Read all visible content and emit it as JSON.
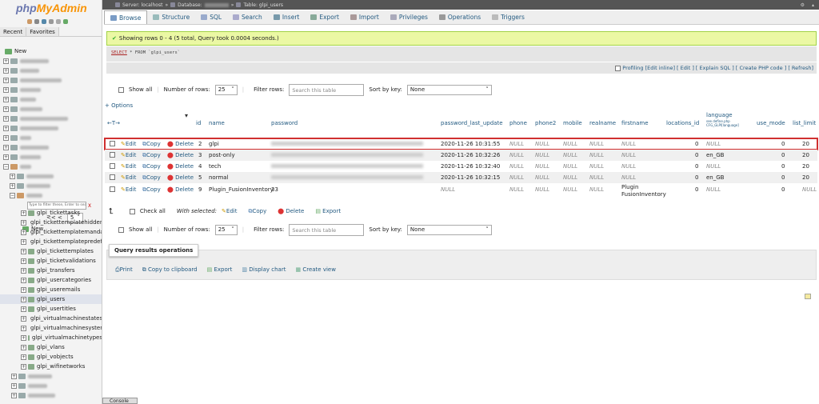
{
  "logo": {
    "a": "php",
    "b": "MyAdmin"
  },
  "left": {
    "tabs": [
      "Recent",
      "Favorites"
    ],
    "new_label": "New",
    "tables": [
      "glpi_tickettasks",
      "glpi_tickettemplatehiddenf",
      "glpi_tickettemplatemandat",
      "glpi_tickettemplatepredefi",
      "glpi_tickettemplates",
      "glpi_ticketvalidations",
      "glpi_transfers",
      "glpi_usercategories",
      "glpi_useremails",
      "glpi_users",
      "glpi_usertitles",
      "glpi_virtualmachinestates",
      "glpi_virtualmachinesystem",
      "glpi_virtualmachinetypes",
      "glpi_vlans",
      "glpi_vobjects",
      "glpi_wifinetworks"
    ],
    "filter_placeholder": "Type to filter these, Enter to search all",
    "filter_x": "X",
    "pager_prev": "<< <",
    "pager_val": "5"
  },
  "breadcrumb": {
    "server": "Server: localhost",
    "db": "Database:",
    "table": "Table: glpi_users"
  },
  "tabs": [
    "Browse",
    "Structure",
    "SQL",
    "Search",
    "Insert",
    "Export",
    "Import",
    "Privileges",
    "Operations",
    "Triggers"
  ],
  "message": "Showing rows 0 - 4 (5 total, Query took 0.0004 seconds.)",
  "sql": {
    "select": "SELECT",
    "rest": " * FROM `glpi_users`"
  },
  "sql_links": "Profiling [Edit inline] [ Edit ] [ Explain SQL ] [ Create PHP code ] [ Refresh]",
  "nav": {
    "show_all": "Show all",
    "num_rows_label": "Number of rows:",
    "num_rows": "25",
    "filter_label": "Filter rows:",
    "filter_placeholder": "Search this table",
    "sort_label": "Sort by key:",
    "sort_val": "None"
  },
  "options": "+ Options",
  "columns": {
    "id": "id",
    "name": "name",
    "password": "password",
    "plu": "password_last_update",
    "phone": "phone",
    "phone2": "phone2",
    "mobile": "mobile",
    "realname": "realname",
    "firstname": "firstname",
    "locations_id": "locations_id",
    "language": "language",
    "language_sub": "see define.php CFG_GLPI[language]",
    "use_mode": "use_mode",
    "list_limit": "list_limit"
  },
  "actions": {
    "edit": "Edit",
    "copy": "Copy",
    "delete": "Delete"
  },
  "rows": [
    {
      "id": "2",
      "name": "glpi",
      "plu": "2020-11-26 10:31:55",
      "phone": "NULL",
      "phone2": "NULL",
      "mobile": "NULL",
      "realname": "NULL",
      "firstname": "NULL",
      "loc": "0",
      "lang": "NULL",
      "use": "0",
      "limit": "20"
    },
    {
      "id": "3",
      "name": "post-only",
      "plu": "2020-11-26 10:32:26",
      "phone": "NULL",
      "phone2": "NULL",
      "mobile": "NULL",
      "realname": "NULL",
      "firstname": "NULL",
      "loc": "0",
      "lang": "en_GB",
      "use": "0",
      "limit": "20"
    },
    {
      "id": "4",
      "name": "tech",
      "plu": "2020-11-26 10:32:40",
      "phone": "NULL",
      "phone2": "NULL",
      "mobile": "NULL",
      "realname": "NULL",
      "firstname": "NULL",
      "loc": "0",
      "lang": "NULL",
      "use": "0",
      "limit": "20"
    },
    {
      "id": "5",
      "name": "normal",
      "plu": "2020-11-26 10:32:15",
      "phone": "NULL",
      "phone2": "NULL",
      "mobile": "NULL",
      "realname": "NULL",
      "firstname": "NULL",
      "loc": "0",
      "lang": "en_GB",
      "use": "0",
      "limit": "20"
    },
    {
      "id": "9",
      "name": "Plugin_FusionInventory",
      "pw": "33",
      "plu": "NULL",
      "phone": "NULL",
      "phone2": "NULL",
      "mobile": "NULL",
      "realname": "NULL",
      "firstname": "Plugin FusionInventory",
      "loc": "0",
      "lang": "NULL",
      "use": "0",
      "limit": "NULL"
    }
  ],
  "bulk": {
    "check_all": "Check all",
    "with_selected": "With selected:",
    "edit": "Edit",
    "copy": "Copy",
    "delete": "Delete",
    "export": "Export"
  },
  "qro": {
    "legend": "Query results operations",
    "print": "Print",
    "copy": "Copy to clipboard",
    "export": "Export",
    "chart": "Display chart",
    "view": "Create view"
  },
  "console": "Console"
}
